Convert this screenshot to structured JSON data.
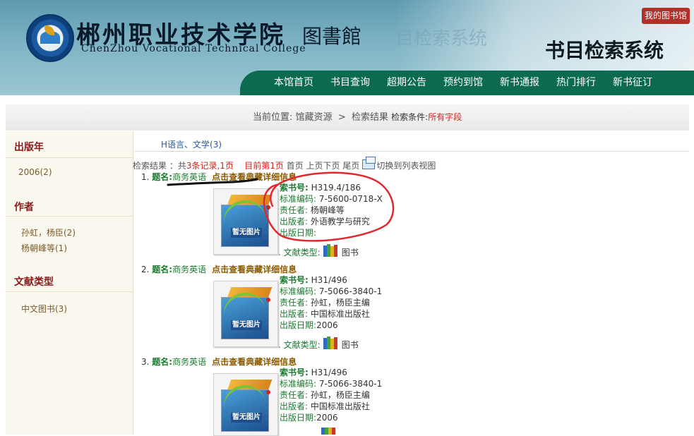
{
  "header": {
    "college_cn": "郴州职业技术学院",
    "library_cn": "图書館",
    "college_en": "ChenZhou Vocational Technical College",
    "ghost_title": "目检索系统",
    "system_title": "书目检索系统",
    "my_library_label": "我的图书馆"
  },
  "nav": {
    "items": [
      {
        "label": "本馆首页"
      },
      {
        "label": "书目查询"
      },
      {
        "label": "超期公告"
      },
      {
        "label": "预约到馆"
      },
      {
        "label": "新书通报"
      },
      {
        "label": "热门排行"
      },
      {
        "label": "新书征订"
      }
    ]
  },
  "breadcrumb": {
    "prefix": "当前位置:",
    "level1": "馆藏资源",
    "separator": ">",
    "level2": "检索结果",
    "condition_label": "检索条件:",
    "condition_value": "所有字段"
  },
  "sidebar": {
    "facets": [
      {
        "title": "出版年",
        "items": [
          "2006(2)"
        ]
      },
      {
        "title": "作者",
        "items": [
          "孙虹，杨臣(2)",
          "杨朝峰等(1)"
        ]
      },
      {
        "title": "文献类型",
        "items": [
          "中文图书(3)"
        ]
      }
    ]
  },
  "main": {
    "subject_tab": "H语言、文学(3)",
    "summary": {
      "prefix": "检索结果 ：共",
      "records": "3条记录,1页",
      "current": "目前第1页",
      "first": "首页",
      "prev_next": "上页下页",
      "last": "尾页",
      "switch_view": "切换到列表视图"
    },
    "labels": {
      "title": "题名:",
      "detail_link": "点击查看典藏详细信息",
      "call_no": "索书号",
      "isbn": "标准编码",
      "author": "责任者",
      "publisher": "出版者",
      "pub_date": "出版日期",
      "doc_type": ". 文献类型:",
      "cover_text": "暂无图片"
    },
    "records": [
      {
        "num": "1.",
        "title": "商务英语",
        "call_no": "H319.4/186",
        "isbn": "7-5600-0718-X",
        "author": "杨朝峰等",
        "publisher": "外语教学与研究",
        "pub_date": "",
        "doc_type": "图书"
      },
      {
        "num": "2.",
        "title": "商务英语",
        "call_no": "H31/496",
        "isbn": "7-5066-3840-1",
        "author": "孙虹，杨臣主编",
        "publisher": "中国标准出版社",
        "pub_date": "2006",
        "doc_type": "图书"
      },
      {
        "num": "3.",
        "title": "商务英语",
        "call_no": "H31/496",
        "isbn": "7-5066-3840-1",
        "author": "孙虹，杨臣主编",
        "publisher": "中国标准出版社",
        "pub_date": "2006",
        "doc_type": ""
      }
    ]
  },
  "colors": {
    "nav_green": "#0c6a50",
    "facet_title": "#8b1a1a",
    "label_green": "#1a7a2e",
    "accent_red": "#d0241b",
    "annotation_red": "#e0282e"
  }
}
